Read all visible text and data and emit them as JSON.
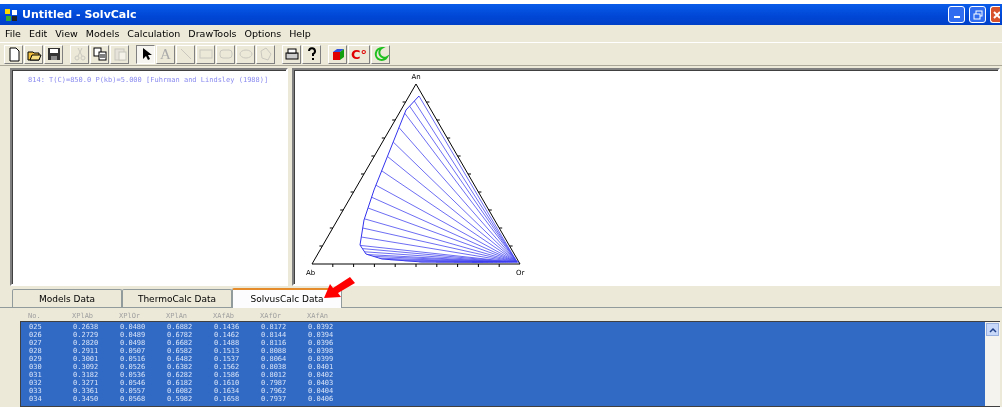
{
  "window": {
    "title": "Untitled - SolvCalc"
  },
  "menu": [
    "File",
    "Edit",
    "View",
    "Models",
    "Calculation",
    "DrawTools",
    "Options",
    "Help"
  ],
  "toolbar": [
    {
      "kind": "new",
      "disabled": false,
      "pressed": false
    },
    {
      "kind": "open",
      "disabled": false,
      "pressed": false
    },
    {
      "kind": "save",
      "disabled": false,
      "pressed": false
    },
    {
      "kind": "cut",
      "disabled": true,
      "pressed": false
    },
    {
      "kind": "copy",
      "disabled": false,
      "pressed": false
    },
    {
      "kind": "paste",
      "disabled": true,
      "pressed": false
    },
    {
      "kind": "pointer",
      "disabled": false,
      "pressed": true
    },
    {
      "kind": "text",
      "label": "A",
      "disabled": true,
      "pressed": false
    },
    {
      "kind": "line",
      "disabled": true,
      "pressed": false
    },
    {
      "kind": "rect",
      "disabled": true,
      "pressed": false
    },
    {
      "kind": "roundrect",
      "disabled": true,
      "pressed": false
    },
    {
      "kind": "ellipse",
      "disabled": true,
      "pressed": false
    },
    {
      "kind": "polygon",
      "disabled": true,
      "pressed": false
    },
    {
      "kind": "print",
      "disabled": false,
      "pressed": false
    },
    {
      "kind": "help",
      "disabled": false,
      "pressed": false
    },
    {
      "kind": "cube",
      "disabled": false,
      "pressed": false
    },
    {
      "kind": "temp",
      "label": "C°",
      "disabled": false,
      "pressed": false
    },
    {
      "kind": "moon",
      "disabled": false,
      "pressed": false
    }
  ],
  "log_pane": {
    "lines": [
      "814: T(C)=850.0 P(kb)=5.000 [Fuhrman and Lindsley (1988)]"
    ]
  },
  "plot": {
    "apex_labels": {
      "top": "An",
      "left": "Ab",
      "right": "Or"
    }
  },
  "tabs": [
    {
      "label": "Models Data",
      "selected": false
    },
    {
      "label": "ThermoCalc Data",
      "selected": false
    },
    {
      "label": "SolvusCalc Data",
      "selected": true
    }
  ],
  "table": {
    "columns": [
      "No.",
      "XPlAb",
      "XPlOr",
      "XPlAn",
      "XAfAb",
      "XAfOr",
      "XAfAn"
    ],
    "rows": [
      [
        "025",
        "0.2638",
        "0.0480",
        "0.6882",
        "0.1436",
        "0.8172",
        "0.0392"
      ],
      [
        "026",
        "0.2729",
        "0.0489",
        "0.6782",
        "0.1462",
        "0.8144",
        "0.0394"
      ],
      [
        "027",
        "0.2820",
        "0.0498",
        "0.6682",
        "0.1488",
        "0.8116",
        "0.0396"
      ],
      [
        "028",
        "0.2911",
        "0.0507",
        "0.6582",
        "0.1513",
        "0.8088",
        "0.0398"
      ],
      [
        "029",
        "0.3001",
        "0.0516",
        "0.6482",
        "0.1537",
        "0.8064",
        "0.0399"
      ],
      [
        "030",
        "0.3092",
        "0.0526",
        "0.6382",
        "0.1562",
        "0.8038",
        "0.0401"
      ],
      [
        "031",
        "0.3182",
        "0.0536",
        "0.6282",
        "0.1586",
        "0.8012",
        "0.0402"
      ],
      [
        "032",
        "0.3271",
        "0.0546",
        "0.6182",
        "0.1610",
        "0.7987",
        "0.0403"
      ],
      [
        "033",
        "0.3361",
        "0.0557",
        "0.6082",
        "0.1634",
        "0.7962",
        "0.0404"
      ],
      [
        "034",
        "0.3450",
        "0.0568",
        "0.5982",
        "0.1658",
        "0.7937",
        "0.0406"
      ]
    ]
  }
}
